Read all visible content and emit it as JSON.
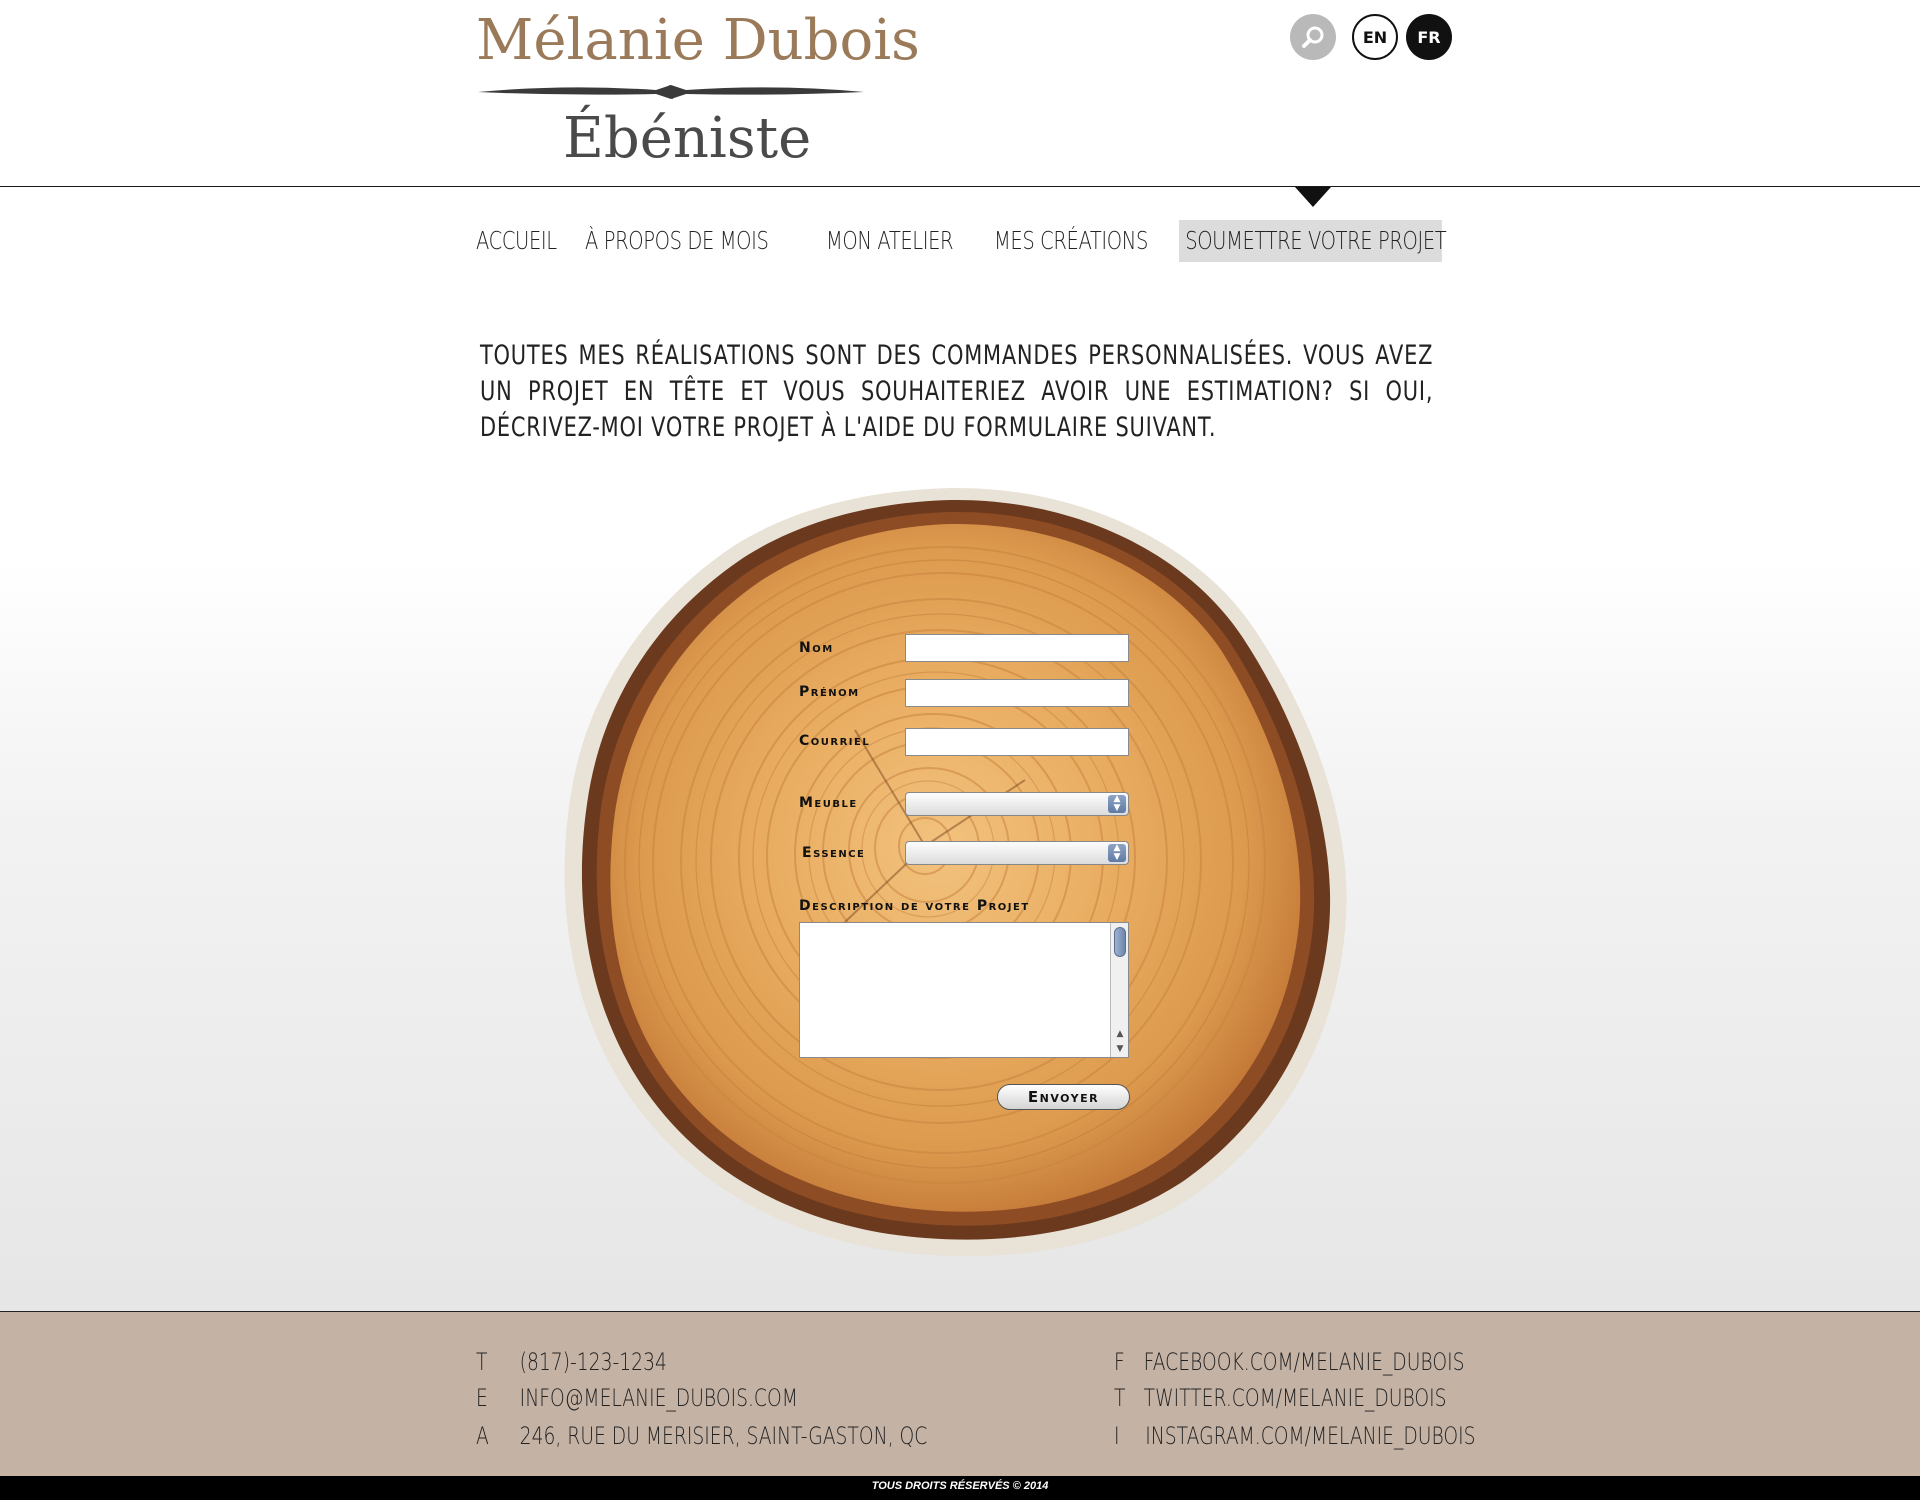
{
  "brand": {
    "name": "Mélanie Dubois",
    "subtitle": "Ébéniste"
  },
  "header": {
    "search_icon": "search-icon",
    "lang_en": "EN",
    "lang_fr": "FR",
    "active_lang": "FR"
  },
  "nav": {
    "items": [
      {
        "label": "ACCUEIL"
      },
      {
        "label": "À PROPOS DE MOIS"
      },
      {
        "label": "MON ATELIER"
      },
      {
        "label": "MES CRÉATIONS"
      },
      {
        "label": "SOUMETTRE VOTRE PROJET"
      }
    ],
    "active": "SOUMETTRE VOTRE PROJET"
  },
  "intro": {
    "text": "Toutes mes réalisations sont des commandes personnalisées. Vous avez un projet en tête et vous souhaiteriez avoir une estimation? Si oui, décrivez-moi votre projet à l'aide du formulaire suivant."
  },
  "form": {
    "nom_label": "Nom",
    "prenom_label": "Prénom",
    "courriel_label": "Courriel",
    "meuble_label": "Meuble",
    "essence_label": "Essence",
    "description_label": "Description de votre Projet",
    "nom_value": "",
    "prenom_value": "",
    "courriel_value": "",
    "meuble_value": "",
    "essence_value": "",
    "description_value": "",
    "submit_label": "Envoyer"
  },
  "footer": {
    "contacts": [
      {
        "letter": "T",
        "value": "(817)-123-1234"
      },
      {
        "letter": "E",
        "value": "info@melanie_dubois.com"
      },
      {
        "letter": "A",
        "value": "246, rue du Merisier, Saint-Gaston, QC"
      }
    ],
    "social": [
      {
        "letter": "F",
        "value": "facebook.com/melanie_dubois"
      },
      {
        "letter": "T",
        "value": "twitter.com/melanie_dubois"
      },
      {
        "letter": "I",
        "value": "instagram.com/melanie_dubois"
      }
    ],
    "copyright": "TOUS DROITS RÉSERVÉS © 2014"
  },
  "colors": {
    "brand": "#9b7a5a",
    "footer_bg": "#c4b2a5",
    "wood_light": "#e6a95c",
    "wood_dark": "#8a4a22",
    "bark": "#5b3018"
  }
}
